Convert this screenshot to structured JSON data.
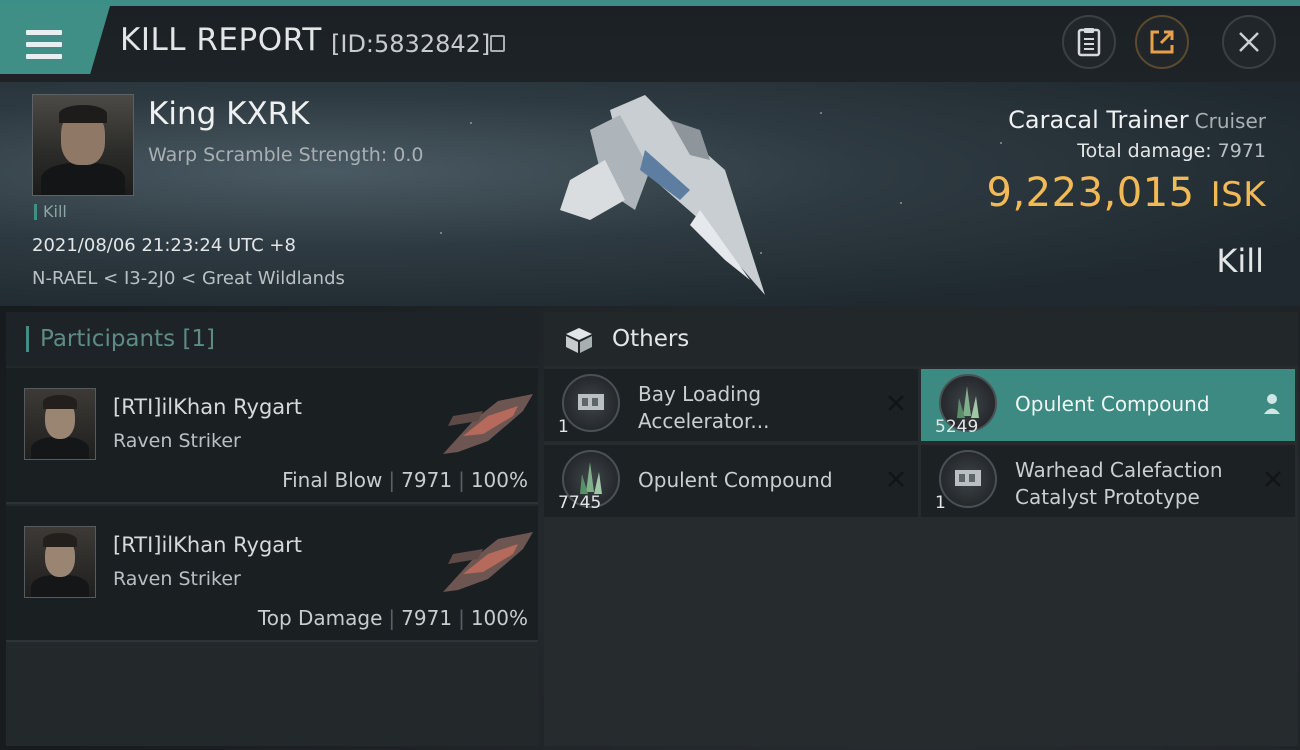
{
  "header": {
    "title": "KILL REPORT",
    "kill_id": "[ID:5832842]",
    "colors": {
      "accent": "#3f8f86",
      "isk": "#f2b957"
    }
  },
  "victim": {
    "name": "King KXRK",
    "warp_scramble": "Warp Scramble Strength: 0.0",
    "tag": "Kill",
    "datetime": "2021/08/06 21:23:24 UTC +8",
    "location": "N-RAEL < I3-2J0 < Great Wildlands"
  },
  "ship": {
    "name": "Caracal Trainer",
    "class": "Cruiser",
    "total_damage_label": "Total damage:",
    "total_damage": "7971",
    "isk_value": "9,223,015",
    "isk_unit": "ISK",
    "result": "Kill"
  },
  "participants": {
    "header": "Participants [1]",
    "rows": [
      {
        "name": "[RTI]ilKhan Rygart",
        "ship": "Raven Striker",
        "role": "Final Blow",
        "damage": "7971",
        "percent": "100%"
      },
      {
        "name": "[RTI]ilKhan Rygart",
        "ship": "Raven Striker",
        "role": "Top Damage",
        "damage": "7971",
        "percent": "100%"
      }
    ]
  },
  "others": {
    "header": "Others",
    "items": [
      {
        "name": "Bay Loading Accelerator...",
        "qty": "1",
        "icon": "module-icon"
      },
      {
        "name": "Opulent Compound",
        "qty": "5249",
        "icon": "crystal-icon"
      },
      {
        "name": "Opulent Compound",
        "qty": "7745",
        "icon": "crystal-icon"
      },
      {
        "name": "Warhead Calefaction Catalyst Prototype",
        "qty": "1",
        "icon": "module-icon"
      }
    ]
  }
}
